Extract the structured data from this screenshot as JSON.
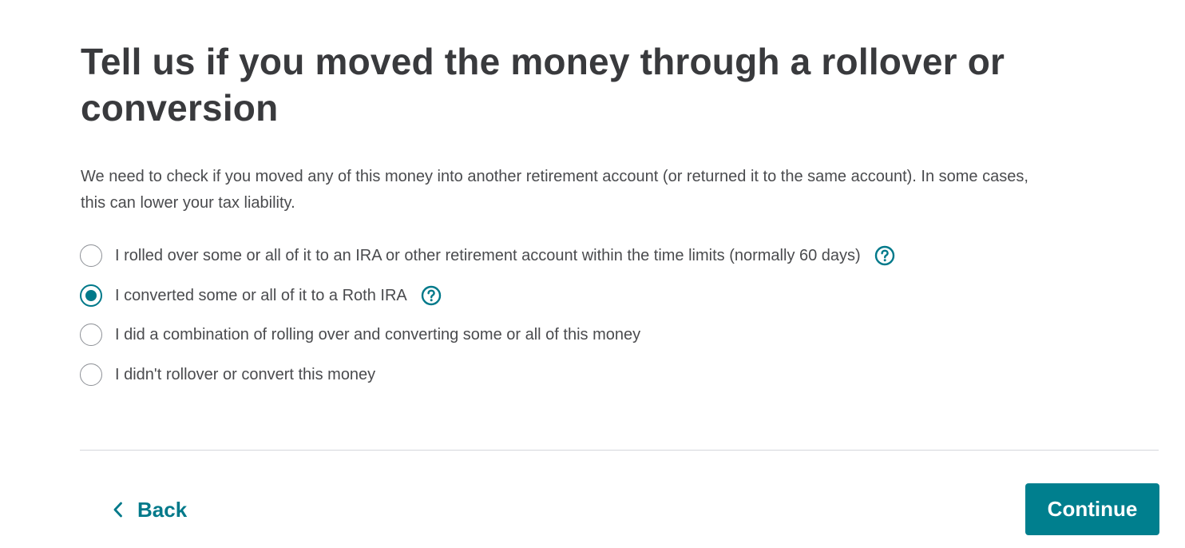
{
  "page": {
    "title": "Tell us if you moved the money through a rollover or conversion",
    "description": "We need to check if you moved any of this money into another retirement account (or returned it to the same account). In some cases, this can lower your tax liability."
  },
  "options": [
    {
      "label": "I rolled over some or all of it to an IRA or other retirement account within the time limits (normally 60 days)",
      "selected": false,
      "help_icon": "question-circle-icon"
    },
    {
      "label": "I converted some or all of it to a Roth IRA",
      "selected": true,
      "help_icon": "question-circle-icon"
    },
    {
      "label": "I did a combination of rolling over and converting some or all of this money",
      "selected": false
    },
    {
      "label": "I didn't rollover or convert this money",
      "selected": false
    }
  ],
  "navigation": {
    "back_label": "Back",
    "back_icon": "chevron-left-icon",
    "continue_label": "Continue"
  },
  "colors": {
    "accent": "#00798a",
    "button": "#007f8e",
    "text": "#393a3d",
    "divider": "#d4d7dc"
  }
}
